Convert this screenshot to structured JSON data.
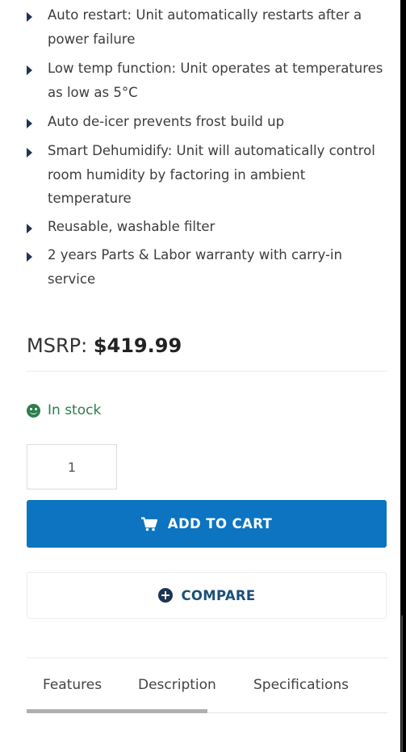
{
  "features": [
    "Auto restart: Unit automatically restarts after a power failure",
    "Low temp function: Unit operates at temperatures as low as 5°C",
    "Auto de-icer prevents frost build up",
    "Smart Dehumidify: Unit will automatically control room humidity by factoring in ambient temperature",
    "Reusable, washable filter",
    "2 years Parts & Labor warranty with carry-in service"
  ],
  "price": {
    "label": "MSRP:",
    "value": "$419.99"
  },
  "stock": {
    "icon": "smile-icon",
    "text": "In stock",
    "color": "#2e7d4f"
  },
  "quantity": {
    "value": "1"
  },
  "add_to_cart": {
    "label": "ADD TO CART",
    "icon": "cart-icon",
    "color": "#0c74c0"
  },
  "compare": {
    "label": "COMPARE",
    "icon": "plus-circle-icon"
  },
  "tabs": [
    {
      "label": "Features",
      "active": true
    },
    {
      "label": "Description",
      "active": false
    },
    {
      "label": "Specifications",
      "active": false
    }
  ]
}
